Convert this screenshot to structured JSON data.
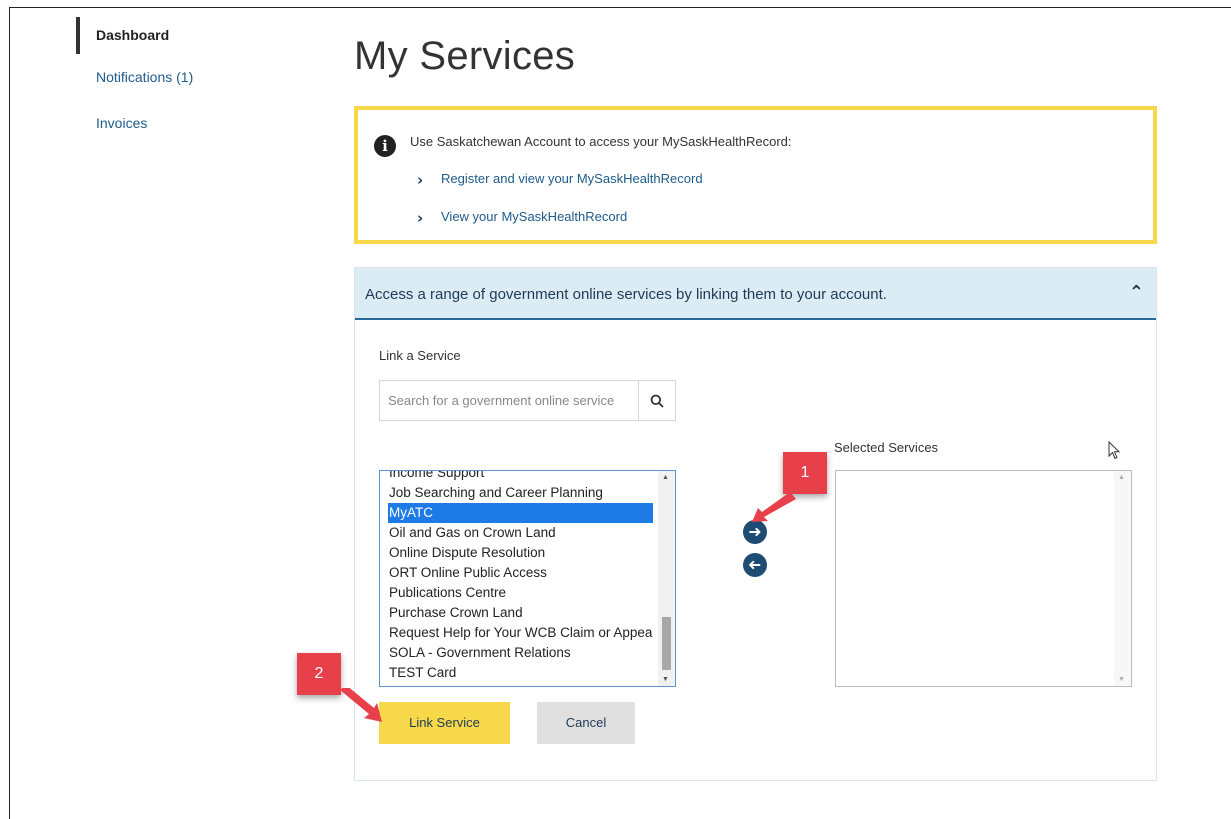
{
  "sidebar": {
    "items": [
      {
        "label": "Dashboard"
      },
      {
        "label": "Notifications (1)"
      },
      {
        "label": "Invoices"
      }
    ]
  },
  "page_title": "My Services",
  "info": {
    "text": "Use Saskatchewan Account to access your MySaskHealthRecord:",
    "links": [
      {
        "label": "Register and view your MySaskHealthRecord"
      },
      {
        "label": "View your MySaskHealthRecord"
      }
    ],
    "border_color": "#f7d84b"
  },
  "panel": {
    "header": "Access a range of government online services by linking them to your account.",
    "link_label": "Link a Service",
    "search_placeholder": "Search for a government online service",
    "services": [
      "Income Support",
      "Job Searching and Career Planning",
      "MyATC",
      "Oil and Gas on Crown Land",
      "Online Dispute Resolution",
      "ORT Online Public Access",
      "Publications Centre",
      "Purchase Crown Land",
      "Request Help for Your WCB Claim or Appeal",
      "SOLA - Government Relations",
      "TEST Card"
    ],
    "selected_service": "MyATC",
    "selected_label": "Selected Services",
    "link_button": "Link Service",
    "cancel_button": "Cancel"
  },
  "annotations": {
    "marker1": "1",
    "marker2": "2"
  },
  "colors": {
    "accent_yellow": "#f7d84b",
    "link_blue": "#1e5b8a",
    "selection_blue": "#1e7be6",
    "marker_red": "#e8404a"
  }
}
